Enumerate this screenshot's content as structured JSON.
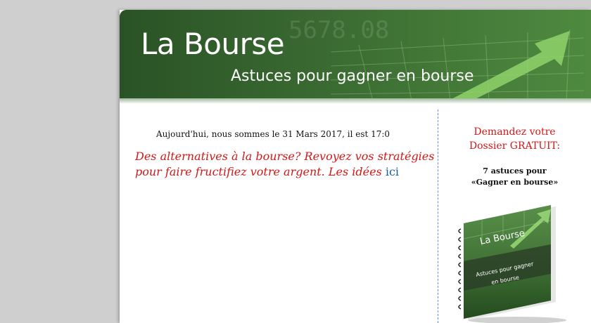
{
  "header": {
    "title": "La Bourse",
    "subtitle": "Astuces pour gagner en bourse"
  },
  "main": {
    "date_line": "Aujourd'hui, nous sommes le 31 Mars 2017, il est 17:0",
    "headline": "Des alternatives à la bourse? Revoyez vos stratégies pour faire fructifiez votre argent. Les idées",
    "headline_link": "ici"
  },
  "sidebar": {
    "cta_line1": "Demandez votre",
    "cta_line2": "Dossier GRATUIT:",
    "tips_line1": "7 astuces pour",
    "tips_line2": "«Gagner en bourse»",
    "book_title": "La Bourse",
    "book_subtitle_line1": "Astuces pour gagner",
    "book_subtitle_line2": "en bourse"
  },
  "colors": {
    "brand_green": "#3c6e33",
    "headline_red": "#d01818",
    "link_blue": "#1a5aa8"
  }
}
